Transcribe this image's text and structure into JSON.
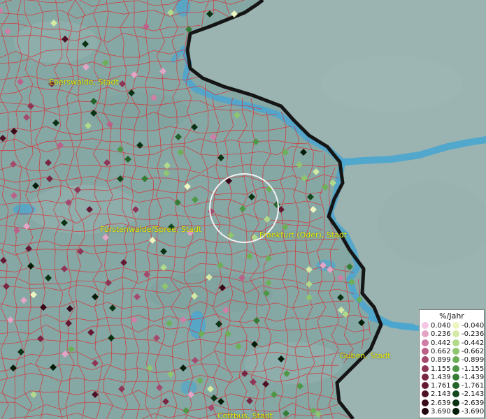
{
  "cities": [
    {
      "id": "eberswalde",
      "name": "Eberswalde, Stadt"
    },
    {
      "id": "fuerstenwalde",
      "name": "Fürstenwalde/Spree, Stadt"
    },
    {
      "id": "frankfurt",
      "name": "Frankfurt (Oder), Stadt"
    },
    {
      "id": "guben",
      "name": "Guben, Stadt"
    },
    {
      "id": "cottbus",
      "name": "Cottbus, Stadt"
    }
  ],
  "legend": {
    "title": "%/Jahr",
    "positive": [
      {
        "label": "0.040",
        "color": "#f4c6e4"
      },
      {
        "label": "0.236",
        "color": "#e3a4c6"
      },
      {
        "label": "0.442",
        "color": "#cf7fa6"
      },
      {
        "label": "0.662",
        "color": "#bb6088"
      },
      {
        "label": "0.899",
        "color": "#a44a6e"
      },
      {
        "label": "1.155",
        "color": "#8f3657"
      },
      {
        "label": "1.439",
        "color": "#792643"
      },
      {
        "label": "1.761",
        "color": "#641a33"
      },
      {
        "label": "2.143",
        "color": "#4e1025"
      },
      {
        "label": "2.639",
        "color": "#380a19"
      },
      {
        "label": "3.690",
        "color": "#22040d"
      }
    ],
    "negative": [
      {
        "label": "-0.040",
        "color": "#eef5c0"
      },
      {
        "label": "-0.236",
        "color": "#d3eaa5"
      },
      {
        "label": "-0.442",
        "color": "#b2d98a"
      },
      {
        "label": "-0.662",
        "color": "#8fc56f"
      },
      {
        "label": "-0.899",
        "color": "#6daf58"
      },
      {
        "label": "-1.155",
        "color": "#4f9645"
      },
      {
        "label": "-1.439",
        "color": "#377c36"
      },
      {
        "label": "-1.761",
        "color": "#236229"
      },
      {
        "label": "-2.143",
        "color": "#14491d"
      },
      {
        "label": "-2.639",
        "color": "#0a3213"
      },
      {
        "label": "-3.690",
        "color": "#031d09"
      }
    ]
  },
  "colors": {
    "land": "#86a8a5",
    "poland": "#9bb4b1",
    "water": "#4aa6cf",
    "district_border": "#d4373b",
    "national_border": "#151515",
    "city_label": "#e6e600"
  }
}
